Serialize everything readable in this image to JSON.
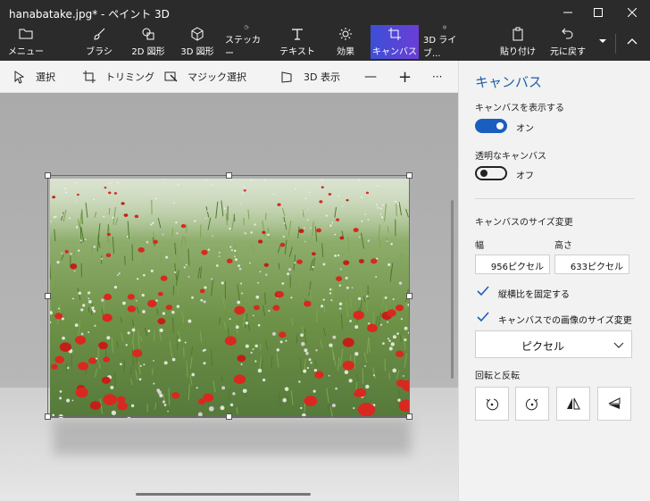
{
  "window": {
    "title": "hanabatake.jpg* - ペイント 3D"
  },
  "ribbon": {
    "tabs": [
      {
        "label": "メニュー",
        "icon": "folder-icon"
      },
      {
        "label": "ブラシ",
        "icon": "brush-icon"
      },
      {
        "label": "2D 図形",
        "icon": "2d-shapes-icon"
      },
      {
        "label": "3D 図形",
        "icon": "3d-shapes-icon"
      },
      {
        "label": "ステッカー",
        "icon": "sticker-icon"
      },
      {
        "label": "テキスト",
        "icon": "text-icon"
      },
      {
        "label": "効果",
        "icon": "effects-icon"
      },
      {
        "label": "キャンバス",
        "icon": "canvas-icon",
        "active": true
      },
      {
        "label": "3D ライブ...",
        "icon": "3d-library-icon"
      }
    ],
    "paste_label": "貼り付け",
    "undo_label": "元に戻す"
  },
  "toolbar": {
    "select_label": "選択",
    "crop_label": "トリミング",
    "magic_select_label": "マジック選択",
    "view3d_label": "3D 表示",
    "zoom_out_symbol": "—",
    "zoom_in_symbol": "+",
    "more_symbol": "···"
  },
  "panel": {
    "title": "キャンバス",
    "show_canvas_label": "キャンバスを表示する",
    "show_canvas_state": "オン",
    "transparent_label": "透明なキャンバス",
    "transparent_state": "オフ",
    "resize_label": "キャンバスのサイズ変更",
    "width_label": "幅",
    "height_label": "高さ",
    "width_value": "956ピクセル",
    "height_value": "633ピクセル",
    "lock_aspect_label": "縦横比を固定する",
    "lock_aspect_checked": true,
    "resize_image_label": "キャンバスでの画像のサイズ変更",
    "resize_image_checked": true,
    "unit_value": "ピクセル",
    "rotate_flip_label": "回転と反転"
  },
  "colors": {
    "accent": "#1a5ebf",
    "title_accent": "#1f5fa8",
    "active_tab_start": "#3d4fd6",
    "active_tab_end": "#6a3ed6",
    "chrome": "#2b2b2b"
  }
}
